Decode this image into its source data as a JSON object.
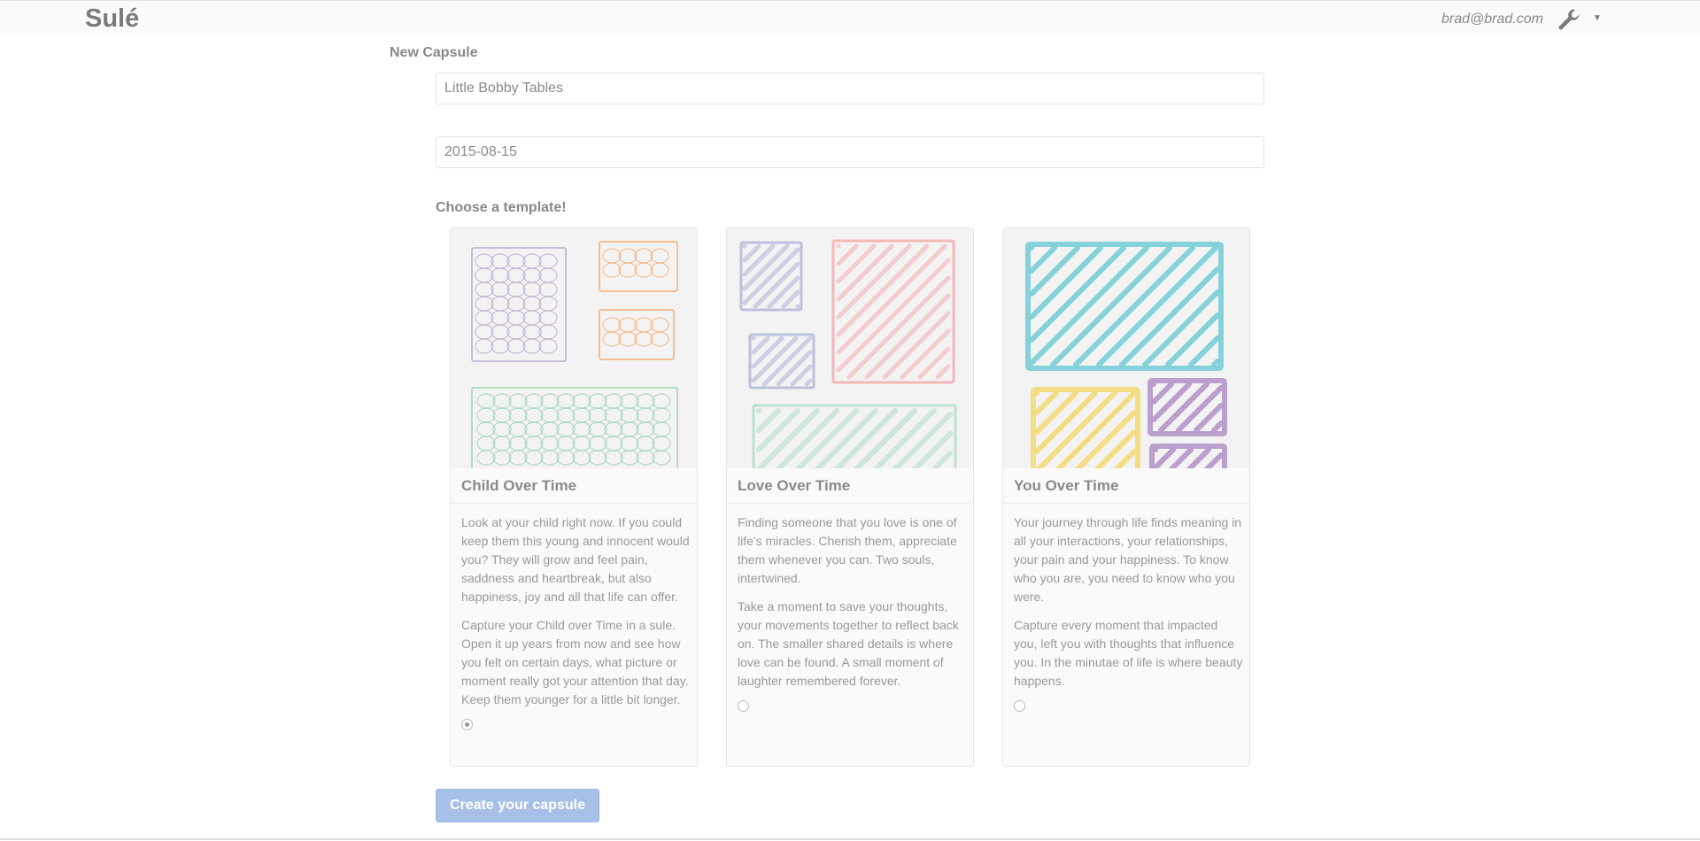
{
  "app": {
    "brand": "Sulé"
  },
  "header": {
    "user_email": "brad@brad.com",
    "settings_icon": "wrench-icon",
    "menu_icon": "caret-down-icon"
  },
  "form": {
    "heading": "New Capsule",
    "name_value": "Little Bobby Tables",
    "date_value": "2015-08-15",
    "template_prompt": "Choose a template!",
    "submit_label": "Create your capsule"
  },
  "templates": [
    {
      "title": "Child Over Time",
      "paragraphs": [
        "Look at your child right now. If you could keep them this young and innocent would you? They will grow and feel pain, saddness and heartbreak, but also happiness, joy and all that life can offer.",
        "Capture your Child over Time in a sule. Open it up years from now and see how you felt on certain days, what picture or moment really got your attention that day. Keep them younger for a little bit longer."
      ],
      "selected": true,
      "colors": [
        "#b7a3cc",
        "#f3a66a",
        "#95d2ad"
      ]
    },
    {
      "title": "Love Over Time",
      "paragraphs": [
        "Finding someone that you love is one of life's miracles. Cherish them, appreciate them whenever you can. Two souls, intertwined.",
        "Take a moment to save your thoughts, your movements together to reflect back on. The smaller shared details is where love can be found. A small moment of laughter remembered forever."
      ],
      "selected": false,
      "colors": [
        "#aab2d6",
        "#f2a7a7",
        "#a8dcc0"
      ]
    },
    {
      "title": "You Over Time",
      "paragraphs": [
        "Your journey through life finds meaning in all your interactions, your relationships, your pain and your happiness. To know who you are, you need to know who you were.",
        "Capture every moment that impacted you, left you with thoughts that influence you. In the minutae of life is where beauty happens."
      ],
      "selected": false,
      "colors": [
        "#7fd0d8",
        "#f3dc7e",
        "#b79acb"
      ]
    }
  ]
}
